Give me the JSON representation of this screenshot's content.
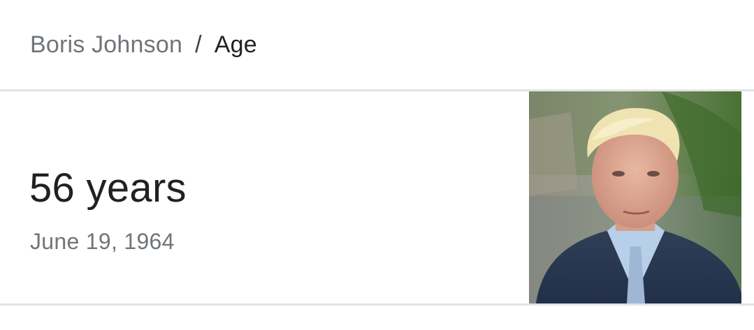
{
  "breadcrumb": {
    "parent": "Boris Johnson",
    "separator": "/",
    "current": "Age"
  },
  "answer": {
    "value": "56 years",
    "date": "June 19, 1964"
  },
  "image": {
    "icon": "person-photo"
  }
}
